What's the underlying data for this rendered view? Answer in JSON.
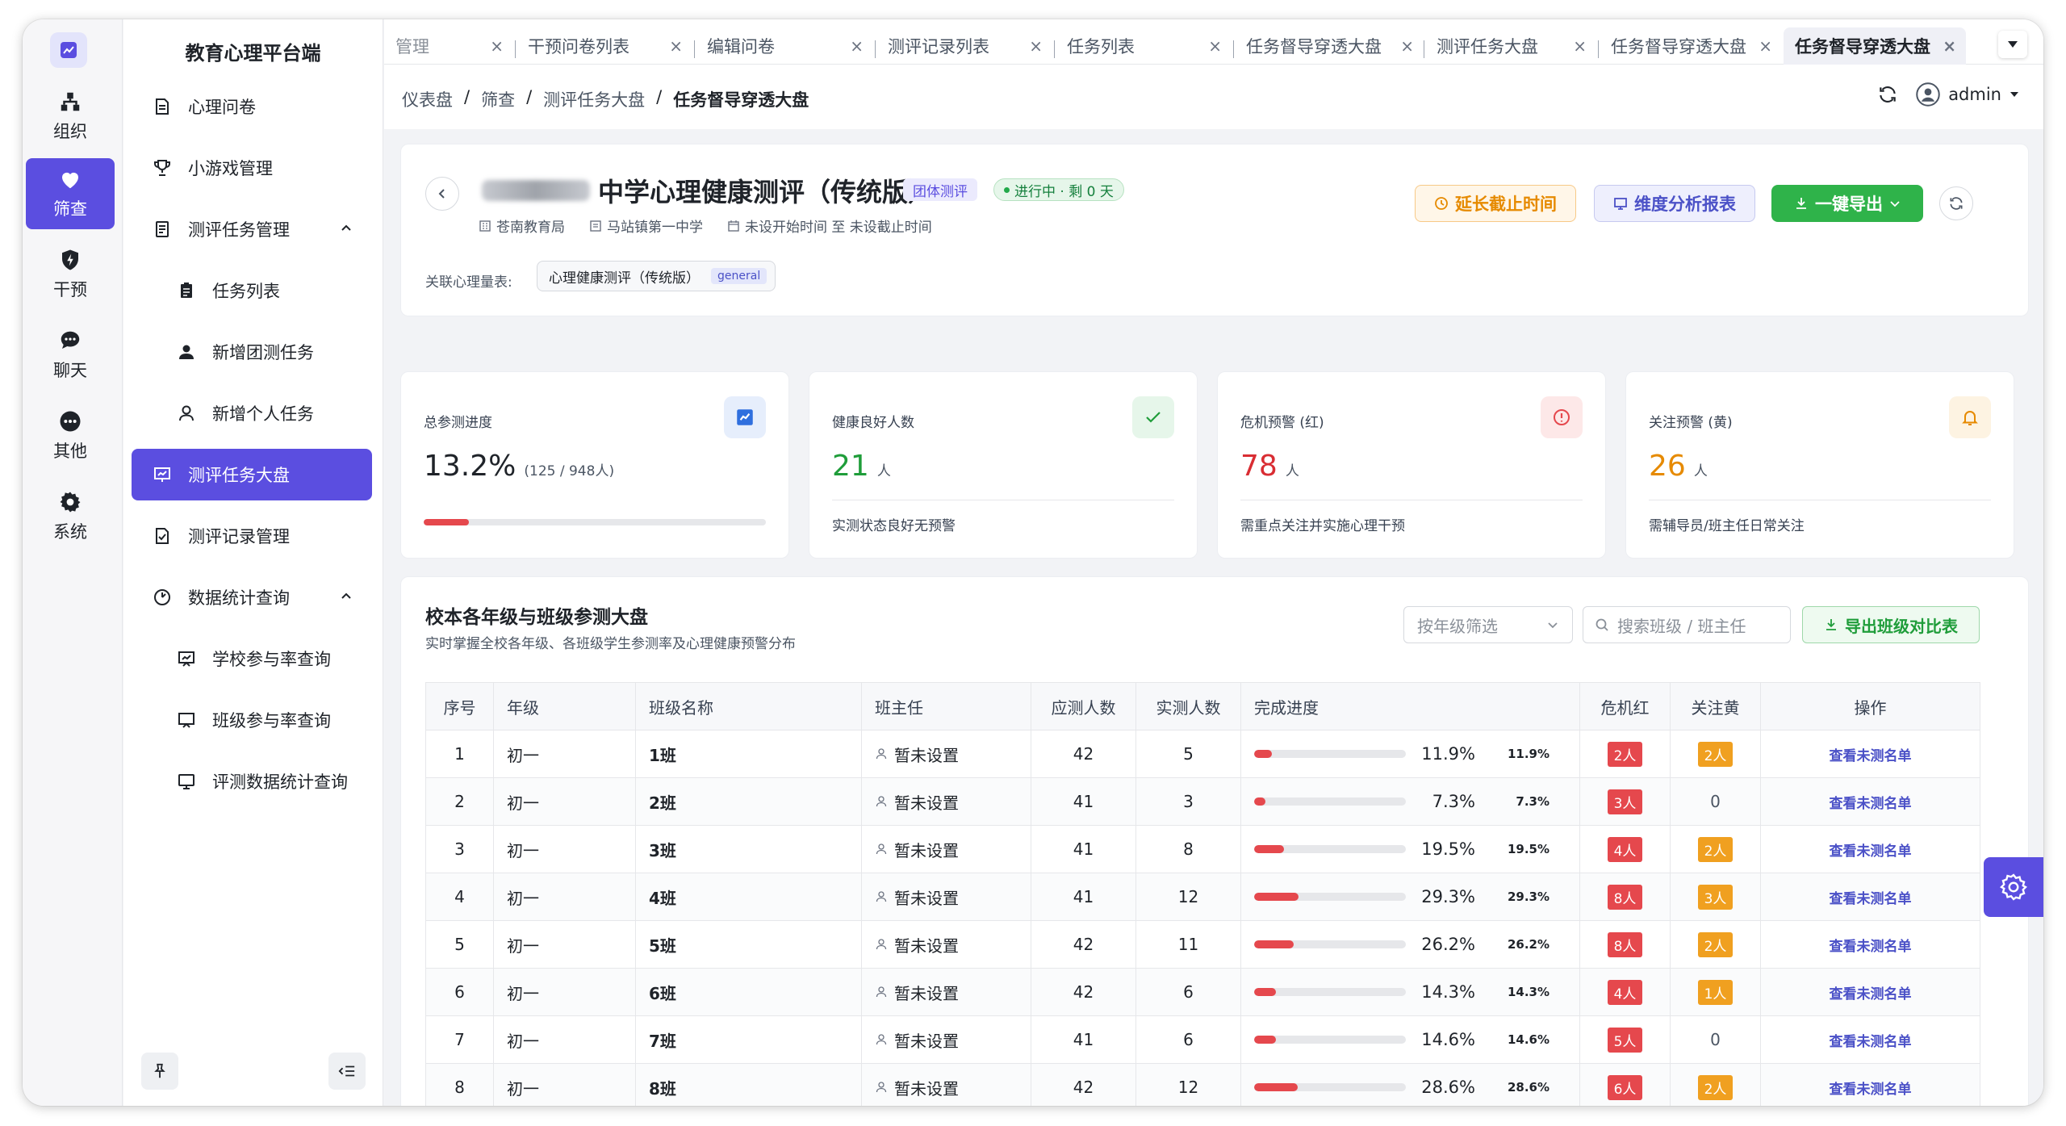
{
  "app": {
    "title": "教育心理平台端"
  },
  "rail": {
    "items": [
      {
        "label": "组织",
        "icon": "org-icon"
      },
      {
        "label": "筛查",
        "icon": "heart-icon"
      },
      {
        "label": "干预",
        "icon": "shield-icon"
      },
      {
        "label": "聊天",
        "icon": "chat-icon"
      },
      {
        "label": "其他",
        "icon": "more-icon"
      },
      {
        "label": "系统",
        "icon": "gear-icon"
      }
    ],
    "active": "筛查"
  },
  "menu": {
    "items": [
      {
        "label": "心理问卷",
        "icon": "questionnaire-icon"
      },
      {
        "label": "小游戏管理",
        "icon": "trophy-icon"
      },
      {
        "label": "测评任务管理",
        "icon": "task-manage-icon"
      },
      {
        "label": "任务列表",
        "icon": "clipboard-icon"
      },
      {
        "label": "新增团测任务",
        "icon": "user-filled-icon"
      },
      {
        "label": "新增个人任务",
        "icon": "user-outline-icon"
      },
      {
        "label": "测评任务大盘",
        "icon": "dashboard-icon"
      },
      {
        "label": "测评记录管理",
        "icon": "record-icon"
      },
      {
        "label": "数据统计查询",
        "icon": "stats-icon"
      },
      {
        "label": "学校参与率查询",
        "icon": "school-chart-icon"
      },
      {
        "label": "班级参与率查询",
        "icon": "class-chart-icon"
      },
      {
        "label": "评测数据统计查询",
        "icon": "monitor-icon"
      }
    ]
  },
  "tabs": [
    {
      "label": "管理"
    },
    {
      "label": "干预问卷列表"
    },
    {
      "label": "编辑问卷"
    },
    {
      "label": "测评记录列表"
    },
    {
      "label": "任务列表"
    },
    {
      "label": "任务督导穿透大盘"
    },
    {
      "label": "测评任务大盘"
    },
    {
      "label": "任务督导穿透大盘"
    },
    {
      "label": "任务督导穿透大盘"
    }
  ],
  "breadcrumb": {
    "items": [
      "仪表盘",
      "筛查",
      "测评任务大盘",
      "任务督导穿透大盘"
    ],
    "sep": "/"
  },
  "user": {
    "name": "admin"
  },
  "task": {
    "title": "中学心理健康测评（传统版）",
    "type_tag": "团体测评",
    "status_tag": "进行中 · 剩 0 天",
    "bureau": "苍南教育局",
    "school": "马站镇第一中学",
    "period": "未设开始时间 至 未设截止时间",
    "scale_label": "关联心理量表:",
    "scale_name": "心理健康测评（传统版）",
    "scale_tag": "general",
    "btn_extend": "延长截止时间",
    "btn_dimension": "维度分析报表",
    "btn_export": "一键导出"
  },
  "stats": {
    "progress": {
      "label": "总参测进度",
      "value": "13.2%",
      "detail": "(125 / 948人)",
      "fraction": 0.132
    },
    "healthy": {
      "label": "健康良好人数",
      "value": "21",
      "unit": "人",
      "desc": "实测状态良好无预警"
    },
    "crisis": {
      "label": "危机预警 (红)",
      "value": "78",
      "unit": "人",
      "desc": "需重点关注并实施心理干预"
    },
    "attention": {
      "label": "关注预警 (黄)",
      "value": "26",
      "unit": "人",
      "desc": "需辅导员/班主任日常关注"
    }
  },
  "table_section": {
    "title": "校本各年级与班级参测大盘",
    "subtitle": "实时掌握全校各年级、各班级学生参测率及心理健康预警分布",
    "grade_filter": "按年级筛选",
    "search_placeholder": "搜索班级 / 班主任",
    "export_btn": "导出班级对比表",
    "columns": [
      "序号",
      "年级",
      "班级名称",
      "班主任",
      "应测人数",
      "实测人数",
      "完成进度",
      "危机红",
      "关注黄",
      "操作"
    ],
    "rows": [
      {
        "no": "1",
        "grade": "初一",
        "cls": "1班",
        "teacher": "暂未设置",
        "expected": "42",
        "actual": "5",
        "pct": "11.9%",
        "frac": 0.119,
        "red": "2人",
        "yellow": "2人",
        "action": "查看未测名单"
      },
      {
        "no": "2",
        "grade": "初一",
        "cls": "2班",
        "teacher": "暂未设置",
        "expected": "41",
        "actual": "3",
        "pct": "7.3%",
        "frac": 0.073,
        "red": "3人",
        "yellow": "0",
        "action": "查看未测名单"
      },
      {
        "no": "3",
        "grade": "初一",
        "cls": "3班",
        "teacher": "暂未设置",
        "expected": "41",
        "actual": "8",
        "pct": "19.5%",
        "frac": 0.195,
        "red": "4人",
        "yellow": "2人",
        "action": "查看未测名单"
      },
      {
        "no": "4",
        "grade": "初一",
        "cls": "4班",
        "teacher": "暂未设置",
        "expected": "41",
        "actual": "12",
        "pct": "29.3%",
        "frac": 0.293,
        "red": "8人",
        "yellow": "3人",
        "action": "查看未测名单"
      },
      {
        "no": "5",
        "grade": "初一",
        "cls": "5班",
        "teacher": "暂未设置",
        "expected": "42",
        "actual": "11",
        "pct": "26.2%",
        "frac": 0.262,
        "red": "8人",
        "yellow": "2人",
        "action": "查看未测名单"
      },
      {
        "no": "6",
        "grade": "初一",
        "cls": "6班",
        "teacher": "暂未设置",
        "expected": "42",
        "actual": "6",
        "pct": "14.3%",
        "frac": 0.143,
        "red": "4人",
        "yellow": "1人",
        "action": "查看未测名单"
      },
      {
        "no": "7",
        "grade": "初一",
        "cls": "7班",
        "teacher": "暂未设置",
        "expected": "41",
        "actual": "6",
        "pct": "14.6%",
        "frac": 0.146,
        "red": "5人",
        "yellow": "0",
        "action": "查看未测名单"
      },
      {
        "no": "8",
        "grade": "初一",
        "cls": "8班",
        "teacher": "暂未设置",
        "expected": "42",
        "actual": "12",
        "pct": "28.6%",
        "frac": 0.286,
        "red": "6人",
        "yellow": "2人",
        "action": "查看未测名单"
      }
    ]
  },
  "colors": {
    "accent": "#5b4ee0",
    "danger": "#e5484d",
    "warning": "#f0a020",
    "success": "#2fb34a"
  }
}
